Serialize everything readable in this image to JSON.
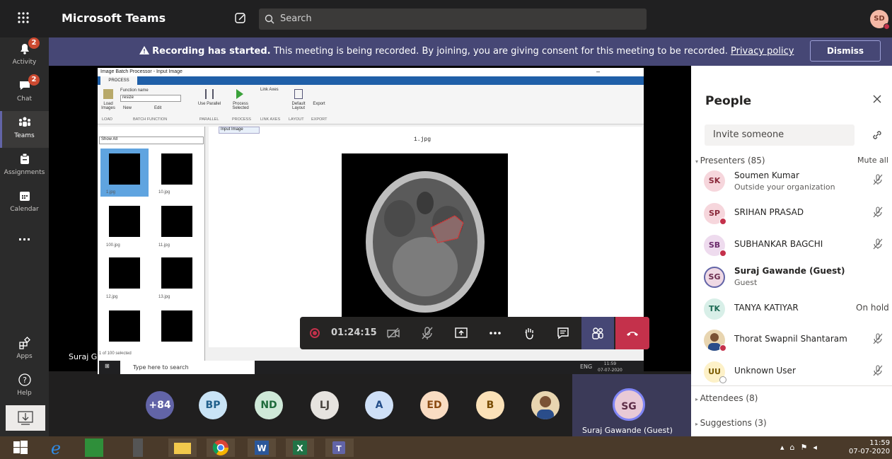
{
  "topbar": {
    "app_name": "Microsoft Teams",
    "search_placeholder": "Search",
    "me_initials": "SD"
  },
  "rail": [
    {
      "label": "Activity",
      "badge": "2"
    },
    {
      "label": "Chat",
      "badge": "2"
    },
    {
      "label": "Teams",
      "badge": ""
    },
    {
      "label": "Assignments",
      "badge": ""
    },
    {
      "label": "Calendar",
      "badge": ""
    },
    {
      "label": "...",
      "badge": ""
    },
    {
      "label": "Apps",
      "badge": ""
    },
    {
      "label": "Help",
      "badge": ""
    }
  ],
  "banner": {
    "bold": "Recording has started.",
    "text": " This meeting is being recorded. By joining, you are giving consent for this meeting to be recorded. ",
    "link": "Privacy policy",
    "dismiss": "Dismiss"
  },
  "shared": {
    "window_title": "Image Batch Processor - Input Image",
    "tab_process": "PROCESS",
    "function_name_label": "Function name",
    "function_value": "resize",
    "load_images": "Load Images",
    "new_label": "New",
    "edit_label": "Edit",
    "use_parallel": "Use Parallel",
    "process_selected": "Process Selected",
    "link_axes": "Link Axes",
    "default_layout": "Default Layout",
    "export": "Export",
    "sections": [
      "LOAD",
      "BATCH FUNCTION",
      "PARALLEL",
      "PROCESS",
      "LINK AXES",
      "LAYOUT",
      "EXPORT"
    ],
    "show_all": "Show All",
    "input_image_tab": "Input Image",
    "image_title": "1.jpg",
    "thumbs": [
      "1.jpg",
      "10.jpg",
      "100.jpg",
      "11.jpg",
      "12.jpg",
      "13.jpg",
      "",
      ""
    ],
    "selected_count": "1 of 100 selected",
    "taskbar_search": "Type here to search",
    "taskbar_clock": "11:59",
    "taskbar_date": "07-07-2020",
    "lang": "ENG"
  },
  "share_owner": "Suraj Gawande (Guest)",
  "callbar": {
    "timer": "01:24:15"
  },
  "avatars": [
    {
      "initials": "+84",
      "bg": "#6264a7",
      "fg": "#ffffff"
    },
    {
      "initials": "BP",
      "bg": "#c9e3f5",
      "fg": "#1f5f8b"
    },
    {
      "initials": "ND",
      "bg": "#cfe9d8",
      "fg": "#1e6b3b"
    },
    {
      "initials": "LJ",
      "bg": "#e6e3df",
      "fg": "#4a4540"
    },
    {
      "initials": "A",
      "bg": "#cfe0f7",
      "fg": "#244e8a"
    },
    {
      "initials": "ED",
      "bg": "#f9dcc2",
      "fg": "#8a4a12"
    },
    {
      "initials": "B",
      "bg": "#fbe1b8",
      "fg": "#7a4d05"
    }
  ],
  "spotlight": {
    "initials": "SG",
    "name": "Suraj Gawande (Guest)"
  },
  "people": {
    "title": "People",
    "invite_placeholder": "Invite someone",
    "presenters": "Presenters (85)",
    "mute_all": "Mute all",
    "list": [
      {
        "initials": "SK",
        "name": "Soumen Kumar",
        "sub": "Outside your organization",
        "bg": "#f6d6dc",
        "fg": "#8a2a3b",
        "dot": false,
        "status": "mic"
      },
      {
        "initials": "SP",
        "name": "SRIHAN PRASAD",
        "sub": "",
        "bg": "#f6d6dc",
        "fg": "#8a2a3b",
        "dot": true,
        "status": "mic"
      },
      {
        "initials": "SB",
        "name": "SUBHANKAR BAGCHI",
        "sub": "",
        "bg": "#eedbee",
        "fg": "#6b2b6b",
        "dot": true,
        "status": "mic"
      },
      {
        "initials": "SG",
        "name": "Suraj Gawande (Guest)",
        "sub": "Guest",
        "bg": "#efd9e4",
        "fg": "#6b2b4e",
        "dot": false,
        "status": "none"
      },
      {
        "initials": "TK",
        "name": "TANYA KATIYAR",
        "sub": "",
        "bg": "#d8efe8",
        "fg": "#1e6b55",
        "dot": false,
        "status": "On hold"
      },
      {
        "initials": "",
        "name": "Thorat Swapnil Shantaram",
        "sub": "",
        "bg": "#e8d5b0",
        "fg": "#333",
        "dot": true,
        "status": "mic"
      },
      {
        "initials": "UU",
        "name": "Unknown User",
        "sub": "",
        "bg": "#fdf1c8",
        "fg": "#7a5a00",
        "dot": false,
        "status": "mic"
      }
    ],
    "attendees": "Attendees (8)",
    "suggestions": "Suggestions (3)"
  },
  "win_taskbar": {
    "time": "11:59",
    "date": "07-07-2020"
  }
}
